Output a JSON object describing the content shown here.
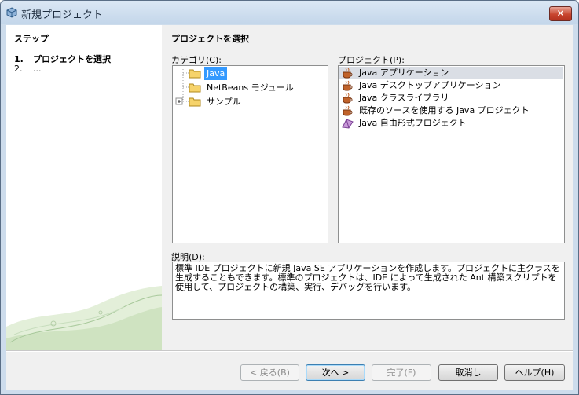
{
  "window": {
    "title": "新規プロジェクト",
    "close_label": "✕"
  },
  "steps": {
    "header": "ステップ",
    "items": [
      {
        "num": "1.",
        "label": "プロジェクトを選択"
      },
      {
        "num": "2.",
        "label": "..."
      }
    ]
  },
  "panel": {
    "title": "プロジェクトを選択"
  },
  "categories": {
    "label": "カテゴリ(C):",
    "items": [
      "Java",
      "NetBeans モジュール",
      "サンプル"
    ]
  },
  "projects": {
    "label": "プロジェクト(P):",
    "items": [
      "Java アプリケーション",
      "Java デスクトップアプリケーション",
      "Java クラスライブラリ",
      "既存のソースを使用する Java プロジェクト",
      "Java 自由形式プロジェクト"
    ]
  },
  "description": {
    "label": "説明(D):",
    "text": "標準 IDE プロジェクトに新規 Java SE アプリケーションを作成します。プロジェクトに主クラスを生成することもできます。標準のプロジェクトは、IDE によって生成された Ant 構築スクリプトを使用して、プロジェクトの構築、実行、デバッグを行います。"
  },
  "buttons": {
    "back": "< 戻る(B)",
    "next": "次へ >",
    "finish": "完了(F)",
    "cancel": "取消し",
    "help": "ヘルプ(H)"
  },
  "colors": {
    "selection": "#3399ff",
    "titlebar": "#cddcec",
    "close": "#c8452f"
  }
}
